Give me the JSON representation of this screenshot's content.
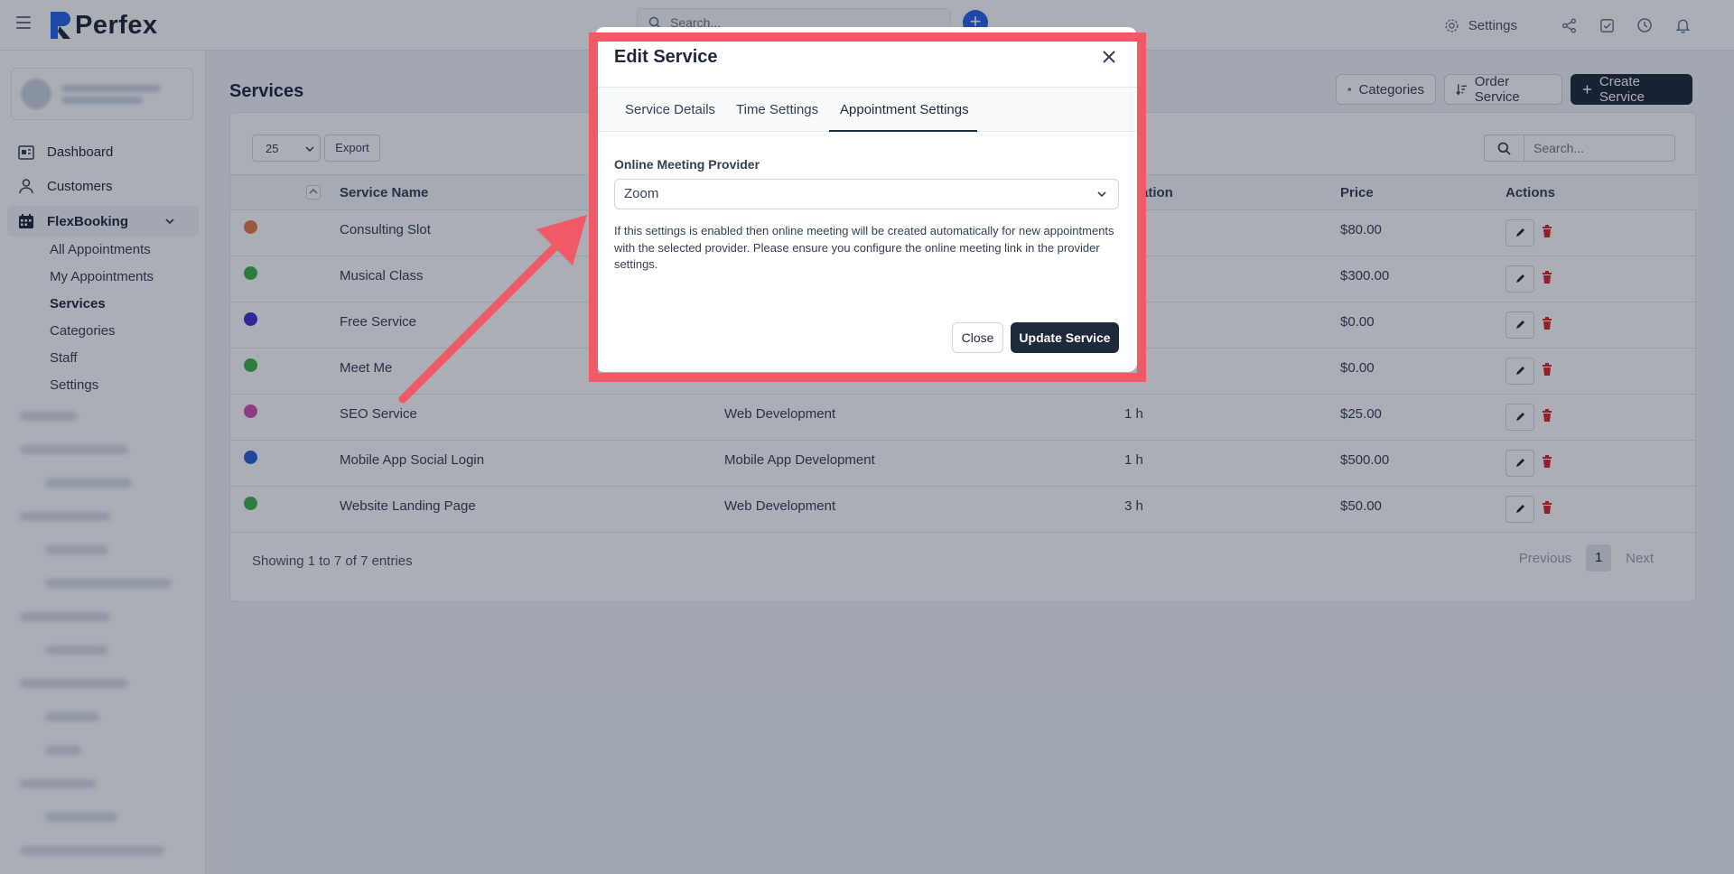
{
  "topbar": {
    "brand": "Perfex",
    "search_placeholder": "Search...",
    "settings_label": "Settings",
    "icons": [
      "share-icon",
      "checkbox-icon",
      "clock-icon",
      "bell-icon"
    ]
  },
  "sidebar": {
    "items": [
      {
        "label": "Dashboard",
        "icon": "dashboard-icon"
      },
      {
        "label": "Customers",
        "icon": "user-icon"
      }
    ],
    "group": {
      "label": "FlexBooking",
      "icon": "calendar-icon"
    },
    "sub_items": [
      {
        "label": "All Appointments"
      },
      {
        "label": "My Appointments"
      },
      {
        "label": "Services",
        "active": true
      },
      {
        "label": "Categories"
      },
      {
        "label": "Staff"
      },
      {
        "label": "Settings"
      }
    ]
  },
  "page": {
    "title": "Services",
    "buttons": {
      "categories": "Categories",
      "order": "Order Service",
      "create": "Create Service"
    }
  },
  "table": {
    "page_size": "25",
    "export_label": "Export",
    "search_placeholder": "Search...",
    "headers": {
      "name": "Service Name",
      "duration": "ation",
      "price": "Price",
      "actions": "Actions"
    },
    "rows": [
      {
        "name": "Consulting Slot",
        "category": "",
        "duration": "",
        "price": "$80.00",
        "color": "#ea7a45"
      },
      {
        "name": "Musical Class",
        "category": "",
        "duration": "",
        "price": "$300.00",
        "color": "#3cb34a"
      },
      {
        "name": "Free Service",
        "category": "",
        "duration": "",
        "price": "$0.00",
        "color": "#3e31d6"
      },
      {
        "name": "Meet Me",
        "category": "",
        "duration": "",
        "price": "$0.00",
        "color": "#3cb34a"
      },
      {
        "name": "SEO Service",
        "category": "Web Development",
        "duration": "1 h",
        "price": "$25.00",
        "color": "#d352b4"
      },
      {
        "name": "Mobile App Social Login",
        "category": "Mobile App Development",
        "duration": "1 h",
        "price": "$500.00",
        "color": "#2b62d9"
      },
      {
        "name": "Website Landing Page",
        "category": "Web Development",
        "duration": "3 h",
        "price": "$50.00",
        "color": "#3cb34a"
      }
    ],
    "footer": "Showing 1 to 7 of 7 entries",
    "pager": {
      "previous": "Previous",
      "page": "1",
      "next": "Next"
    }
  },
  "modal": {
    "title": "Edit Service",
    "tabs": [
      {
        "label": "Service Details"
      },
      {
        "label": "Time Settings"
      },
      {
        "label": "Appointment Settings",
        "active": true
      }
    ],
    "field_label": "Online Meeting Provider",
    "select_value": "Zoom",
    "help_text": "If this settings is enabled then online meeting will be created automatically for new appointments with the selected provider. Please ensure you configure the online meeting link in the provider settings.",
    "close_label": "Close",
    "update_label": "Update Service"
  },
  "annotation": {
    "color": "#f05a66"
  }
}
